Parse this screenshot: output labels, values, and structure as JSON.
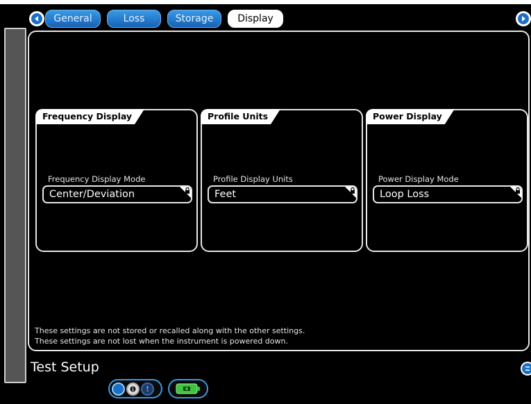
{
  "tabs": [
    {
      "label": "General",
      "active": false
    },
    {
      "label": "Loss",
      "active": false
    },
    {
      "label": "Storage",
      "active": false
    },
    {
      "label": "Display",
      "active": true
    }
  ],
  "cards": [
    {
      "title": "Frequency Display",
      "field_label": "Frequency Display Mode",
      "value": "Center/Deviation",
      "locked": true
    },
    {
      "title": "Profile Units",
      "field_label": "Profile Display Units",
      "value": "Feet",
      "locked": true
    },
    {
      "title": "Power Display",
      "field_label": "Power Display Mode",
      "value": "Loop Loss",
      "locked": true
    }
  ],
  "notes": [
    "These settings are not stored or recalled along with the other settings.",
    "These settings are not lost when the instrument is powered down."
  ],
  "footer": {
    "title": "Test Setup"
  },
  "icons": {
    "prev": "chevron-left-icon",
    "next": "chevron-right-icon",
    "lock": "lock-icon",
    "help": "help-icon",
    "battery": "battery-icon"
  },
  "colors": {
    "accent": "#1b6fc4",
    "tab_bg": "#2a7fd4",
    "battery": "#3ec43e"
  }
}
